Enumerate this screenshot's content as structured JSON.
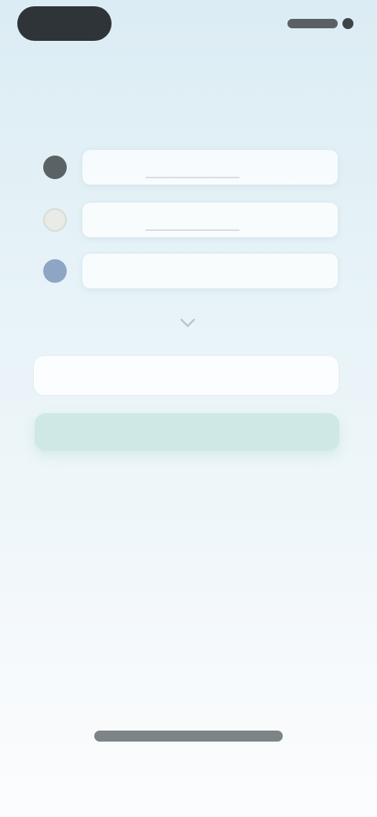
{
  "status": {
    "time_label": "",
    "right_icons": [
      "signal-icon",
      "battery-icon"
    ]
  },
  "header": {
    "sub_link": ""
  },
  "headline": "",
  "options": [
    {
      "label": "",
      "icon": "option-1-icon",
      "color": "#5b6266"
    },
    {
      "label": "",
      "icon": "option-2-icon",
      "color": "#e9ece6"
    },
    {
      "label": "",
      "icon": "option-3-icon",
      "color": "#8ea6c4"
    }
  ],
  "expand": {
    "icon": "chevron-down-icon"
  },
  "input": {
    "value": "",
    "placeholder": ""
  },
  "primary_button": {
    "label": ""
  },
  "footer": {
    "link": ""
  },
  "colors": {
    "accent": "#cfe8e6",
    "background_top": "#dcecf4",
    "background_bottom": "#fbfcfd"
  }
}
